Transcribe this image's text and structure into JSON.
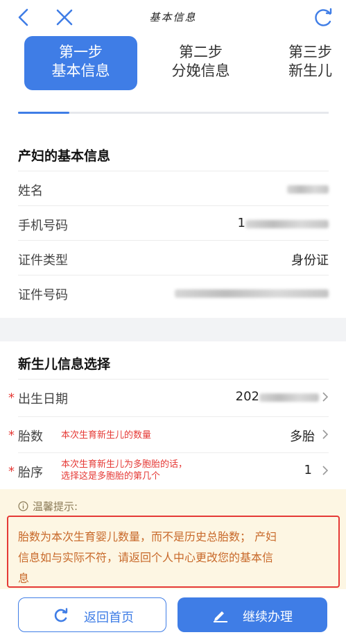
{
  "header": {
    "title": "基本信息",
    "back_icon": "back-arrow-icon",
    "close_icon": "close-icon",
    "refresh_icon": "refresh-icon"
  },
  "steps": [
    {
      "line1": "第一步",
      "line2": "基本信息",
      "active": true
    },
    {
      "line1": "第二步",
      "line2": "分娩信息",
      "active": false
    },
    {
      "line1": "第三步",
      "line2": "新生儿",
      "active": false
    }
  ],
  "mother": {
    "title": "产妇的基本信息",
    "rows": [
      {
        "label": "姓名",
        "value": ""
      },
      {
        "label": "手机号码",
        "value": "1"
      },
      {
        "label": "证件类型",
        "value": "身份证"
      },
      {
        "label": "证件号码",
        "value": ""
      }
    ]
  },
  "newborn": {
    "title": "新生儿信息选择",
    "required_mark": "*",
    "birth_date": {
      "label": "出生日期",
      "value": "202"
    },
    "count": {
      "label": "胎数",
      "hint": "本次生育新生儿的数量",
      "value": "多胎"
    },
    "order": {
      "label": "胎序",
      "hint_line1": "本次生育新生儿为多胞胎的话，",
      "hint_line2": "选择这是多胞胎的第几个",
      "value": "1"
    }
  },
  "tip": {
    "icon": "info-circle-icon",
    "head": "温馨提示:",
    "line1": "胎数为本次生育婴儿数量，而不是历史总胎数； 产妇",
    "line2": "信息如与实际不符，请返回个人中心更改您的基本信",
    "line3": "息"
  },
  "footer": {
    "home_label": "返回首页",
    "continue_label": "继续办理"
  },
  "colors": {
    "accent": "#3f7de6",
    "required": "#e53935",
    "tip_text": "#c8692a"
  }
}
